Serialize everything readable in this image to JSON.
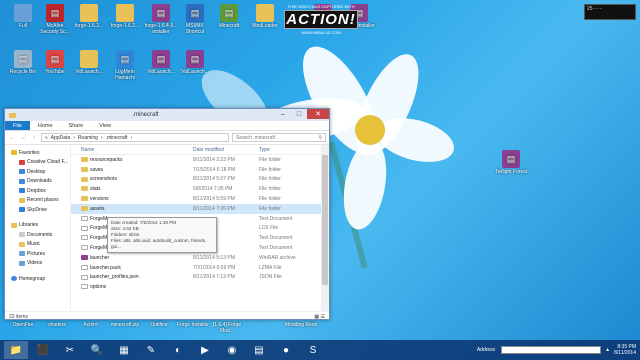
{
  "watermark": {
    "line1": "THIS VIDEO WAS CAPTURED WITH",
    "logo": "ACTION!",
    "line3": "WWW.MIRILLIS.COM"
  },
  "clock_widget": {
    "text": "25 - - -"
  },
  "desktop_icons": [
    {
      "label": "Full",
      "color": "#6aa0d8",
      "icon": "folder-icon"
    },
    {
      "label": "McAfee Security Sc...",
      "color": "#c0242b",
      "icon": "mcafee-icon"
    },
    {
      "label": "forge-1.6.2...",
      "color": "#e8c258",
      "icon": "folder-icon"
    },
    {
      "label": "forge-1.6.2...",
      "color": "#e8c258",
      "icon": "folder-icon"
    },
    {
      "label": "forge-1.6.4-9... installer",
      "color": "#8b3f8f",
      "icon": "winrar-icon"
    },
    {
      "label": "MSI/MX Shortcut",
      "color": "#2a6fbf",
      "icon": "app-icon"
    },
    {
      "label": "Minecraft",
      "color": "#5e9a3a",
      "icon": "minecraft-icon"
    },
    {
      "label": "ModLoader",
      "color": "#e8c258",
      "icon": "folder-icon"
    },
    {
      "label": "forge-1.6.4...",
      "color": "#8b3f8f",
      "icon": "winrar-icon"
    },
    {
      "label": "Forge installer",
      "color": "#8b3f8f",
      "icon": "winrar-icon"
    },
    {
      "label": "Recycle Bin",
      "color": "#9bb4cc",
      "icon": "recycle-bin-icon"
    },
    {
      "label": "YouTube",
      "color": "#d44",
      "icon": "youtube-icon"
    },
    {
      "label": "VidLaunch...",
      "color": "#e8c258",
      "icon": "folder-icon"
    },
    {
      "label": "LogMeIn Hamachi",
      "color": "#2e87d8",
      "icon": "hamachi-icon"
    },
    {
      "label": "VidLaunch...",
      "color": "#8b3f8f",
      "icon": "winrar-icon"
    },
    {
      "label": "VidLaunch...",
      "color": "#8b3f8f",
      "icon": "winrar-icon"
    },
    {
      "label": "Minecraft",
      "color": "#e8c258",
      "icon": "folder-icon"
    },
    {
      "label": "Minecraft",
      "color": "#8b3f8f",
      "icon": "winrar-icon"
    },
    {
      "label": "Minecraft",
      "color": "#8b3f8f",
      "icon": "winrar-icon"
    },
    {
      "label": "Minecraft",
      "color": "#8b3f8f",
      "icon": "winrar-icon"
    }
  ],
  "right_icon": {
    "label": "Twilight Forest",
    "color": "#8b3f8f"
  },
  "bottom_icons": [
    "OpenFire",
    "shaders",
    "Action!",
    "minecraft.zip",
    "Optifine",
    "Forge Installer",
    "[1.6.4] Forge Mod...",
    "Modding Reqs"
  ],
  "explorer": {
    "title": ".minecraft",
    "tabs": [
      "File",
      "Home",
      "Share",
      "View"
    ],
    "breadcrumb": [
      "AppData",
      "Roaming",
      ".minecraft"
    ],
    "search_placeholder": "Search .minecraft",
    "nav": {
      "favorites": "Favorites",
      "favorites_items": [
        "Creative Cloud F...",
        "Desktop",
        "Downloads",
        "Dropbox",
        "Recent places",
        "SkyDrive"
      ],
      "libraries": "Libraries",
      "libraries_items": [
        "Documents",
        "Music",
        "Pictures",
        "Videos"
      ],
      "homegroup": "Homegroup"
    },
    "columns": {
      "name": "Name",
      "date": "Date modified",
      "type": "Type"
    },
    "rows": [
      {
        "name": "resourcepacks",
        "date": "8/11/2014 2:23 PM",
        "type": "File folder",
        "icon": "folder"
      },
      {
        "name": "saves",
        "date": "7/15/2014 6:18 PM",
        "type": "File folder",
        "icon": "folder"
      },
      {
        "name": "screenshots",
        "date": "8/11/2014 5:07 PM",
        "type": "File folder",
        "icon": "folder"
      },
      {
        "name": "stats",
        "date": "5/8/2014 7:35 PM",
        "type": "File folder",
        "icon": "folder"
      },
      {
        "name": "versions",
        "date": "8/11/2014 5:59 PM",
        "type": "File folder",
        "icon": "folder"
      },
      {
        "name": "assets",
        "date": "8/11/2014 7:26 PM",
        "type": "File folder",
        "icon": "folder"
      },
      {
        "name": "ForgeMo...",
        "date": "",
        "type": "Text Document",
        "icon": "doc"
      },
      {
        "name": "ForgeMo...",
        "date": "",
        "type": "LCK File",
        "icon": "doc"
      },
      {
        "name": "ForgeMo...",
        "date": "",
        "type": "Text Document",
        "icon": "doc"
      },
      {
        "name": "ForgeModLoader-server-0",
        "date": "",
        "type": "Text Document",
        "icon": "doc"
      },
      {
        "name": "launcher",
        "date": "8/11/2014 5:13 PM",
        "type": "WinRAR archive",
        "icon": "zip"
      },
      {
        "name": "launcher.pack",
        "date": "7/31/2014 6:59 PM",
        "type": "LZMA File",
        "icon": "doc"
      },
      {
        "name": "launcher_profiles.json",
        "date": "8/11/2014 7:13 PM",
        "type": "JSON File",
        "icon": "doc"
      },
      {
        "name": "options",
        "date": "",
        "type": "",
        "icon": "doc"
      }
    ],
    "tooltip": [
      "Date created: 7/5/2014 1:39 PM",
      "Size: 4.62 KB",
      "Folders: skins",
      "Files: alts, alts.uuid, autobuild_custom, friends, gui..."
    ],
    "status": "23 items"
  },
  "taskbar": {
    "apps": [
      {
        "icon": "file-explorer-icon",
        "glyph": "📁",
        "active": true
      },
      {
        "icon": "app-icon",
        "glyph": "⬛"
      },
      {
        "icon": "tools-icon",
        "glyph": "✂"
      },
      {
        "icon": "magnifier-icon",
        "glyph": "🔍"
      },
      {
        "icon": "minecraft-icon",
        "glyph": "▦"
      },
      {
        "icon": "pen-icon",
        "glyph": "✎"
      },
      {
        "icon": "firefox-icon",
        "glyph": "◐"
      },
      {
        "icon": "media-player-icon",
        "glyph": "▶"
      },
      {
        "icon": "chrome-icon",
        "glyph": "◉"
      },
      {
        "icon": "notes-icon",
        "glyph": "▤"
      },
      {
        "icon": "record-icon",
        "glyph": "●"
      },
      {
        "icon": "skype-icon",
        "glyph": "S"
      }
    ],
    "address_label": "Address",
    "time": "8:35 PM",
    "date": "8/11/2014"
  }
}
